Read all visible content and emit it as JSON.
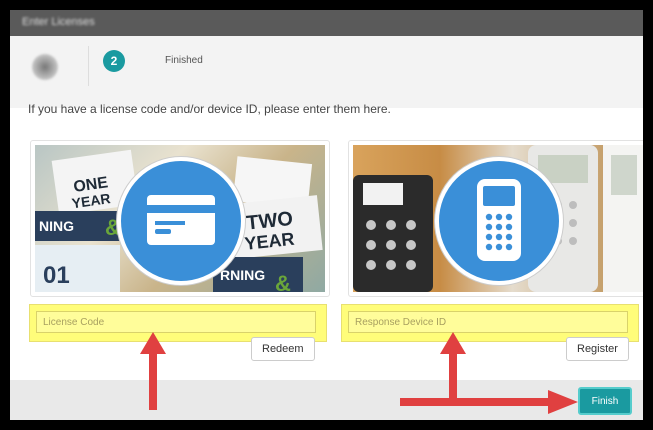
{
  "dialog": {
    "title": "Enter Licenses",
    "steps": {
      "step2_number": "2",
      "step2_label": "Finished"
    },
    "prompt": "If you have a license code and/or device ID, please enter them here.",
    "license": {
      "placeholder": "License Code",
      "button_label": "Redeem"
    },
    "device": {
      "placeholder": "Response Device ID",
      "button_label": "Register"
    },
    "finish_label": "Finish"
  },
  "colors": {
    "accent": "#1a9aa0",
    "highlight": "#fffd7a",
    "annotation_arrow": "#e04040",
    "icon_circle": "#3a8fd8"
  },
  "icons": {
    "license_card": "credit-card-icon",
    "device": "clicker-device-icon"
  }
}
